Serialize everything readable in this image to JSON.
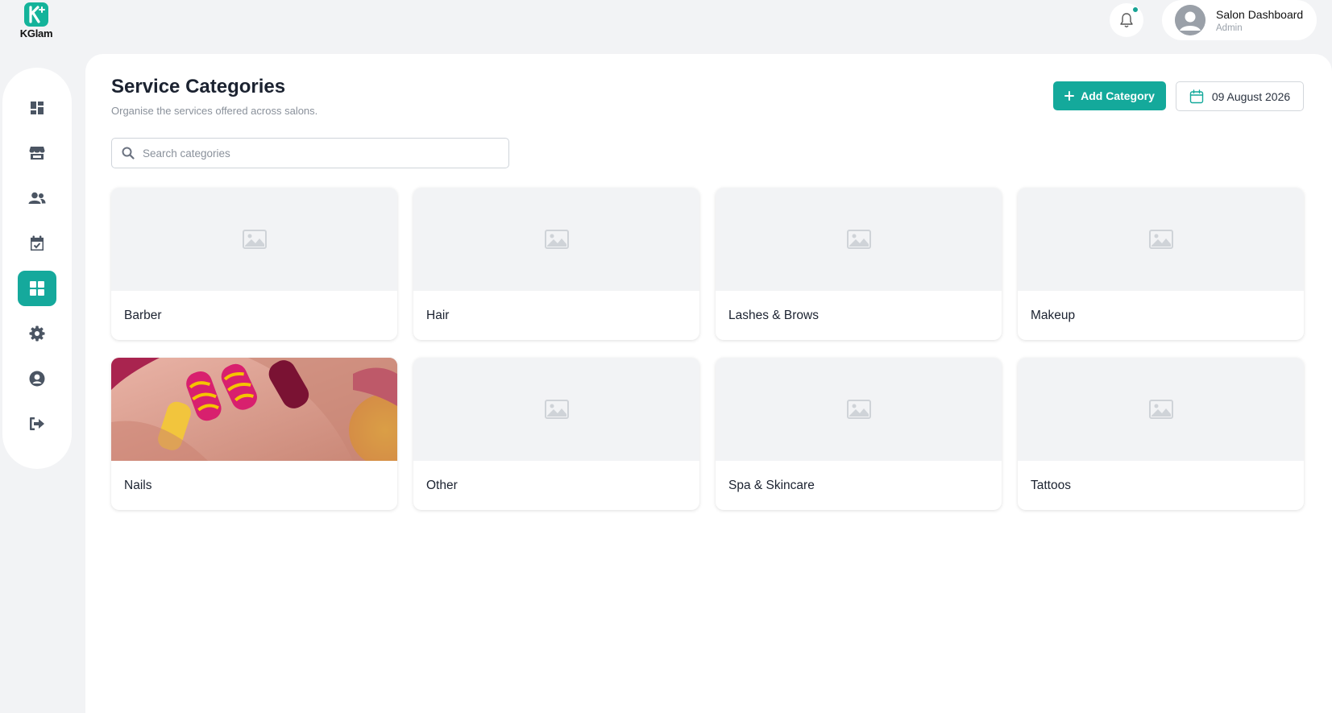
{
  "brand": {
    "name": "KGlam"
  },
  "header": {
    "notifications_icon": "bell-icon",
    "profile": {
      "name": "Salon Dashboard",
      "role": "Admin"
    }
  },
  "sidebar": {
    "items": [
      {
        "icon": "dashboard-icon",
        "active": false
      },
      {
        "icon": "store-icon",
        "active": false
      },
      {
        "icon": "users-icon",
        "active": false
      },
      {
        "icon": "calendar-check-icon",
        "active": false
      },
      {
        "icon": "categories-grid-icon",
        "active": true
      },
      {
        "icon": "gear-icon",
        "active": false
      },
      {
        "icon": "user-circle-icon",
        "active": false
      },
      {
        "icon": "logout-icon",
        "active": false
      }
    ]
  },
  "page": {
    "title": "Service Categories",
    "subtitle": "Organise the services offered across salons.",
    "add_button": "Add Category",
    "date": "09 August 2026"
  },
  "search": {
    "placeholder": "Search categories",
    "value": ""
  },
  "categories": [
    {
      "name": "Barber",
      "has_image": false
    },
    {
      "name": "Hair",
      "has_image": false
    },
    {
      "name": "Lashes & Brows",
      "has_image": false
    },
    {
      "name": "Makeup",
      "has_image": false
    },
    {
      "name": "Nails",
      "has_image": true
    },
    {
      "name": "Other",
      "has_image": false
    },
    {
      "name": "Spa & Skincare",
      "has_image": false
    },
    {
      "name": "Tattoos",
      "has_image": false
    }
  ],
  "colors": {
    "accent": "#14a99b",
    "background": "#f2f3f5"
  }
}
